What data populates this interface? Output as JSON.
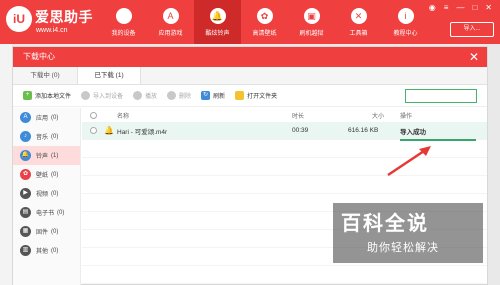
{
  "app": {
    "brand": "爱思助手",
    "url": "www.i4.cn",
    "nav": [
      {
        "label": "我的设备",
        "icon": "apple-icon",
        "glyph": ""
      },
      {
        "label": "应用游戏",
        "icon": "appstore-icon",
        "glyph": "A"
      },
      {
        "label": "酷炫铃声",
        "icon": "bell-icon",
        "glyph": "🔔"
      },
      {
        "label": "高清壁纸",
        "icon": "flower-icon",
        "glyph": "✿"
      },
      {
        "label": "刷机越狱",
        "icon": "box-icon",
        "glyph": "▣"
      },
      {
        "label": "工具箱",
        "icon": "wrench-icon",
        "glyph": "✕"
      },
      {
        "label": "教程中心",
        "icon": "info-icon",
        "glyph": "i"
      }
    ],
    "window_controls": [
      "◉",
      "≡",
      "—",
      "□",
      "✕"
    ],
    "import_label": "导入..."
  },
  "dialog": {
    "title": "下载中心",
    "close": "✕",
    "tabs": [
      {
        "label": "下载中 (0)"
      },
      {
        "label": "已下载 (1)"
      }
    ],
    "toolbar": {
      "add_local": "添加本地文件",
      "import_device": "导入到设备",
      "locate": "播放",
      "delete": "删除",
      "refresh": "刷新",
      "open_folder": "打开文件夹"
    },
    "sidebar": [
      {
        "label": "应用",
        "count": "(0)",
        "color": "#3f8bd8",
        "glyph": "A"
      },
      {
        "label": "音乐",
        "count": "(0)",
        "color": "#3f8bd8",
        "glyph": "♪"
      },
      {
        "label": "铃声",
        "count": "(1)",
        "color": "#3f8bd8",
        "glyph": "🔔"
      },
      {
        "label": "壁纸",
        "count": "(0)",
        "color": "#e8434b",
        "glyph": "✿"
      },
      {
        "label": "视频",
        "count": "(0)",
        "color": "#555555",
        "glyph": "▶"
      },
      {
        "label": "电子书",
        "count": "(0)",
        "color": "#555555",
        "glyph": "▤"
      },
      {
        "label": "固件",
        "count": "(0)",
        "color": "#555555",
        "glyph": "▦"
      },
      {
        "label": "其他",
        "count": "(0)",
        "color": "#555555",
        "glyph": "▥"
      }
    ],
    "table": {
      "headers": {
        "name": "名称",
        "time": "时长",
        "size": "大小",
        "op": "操作"
      },
      "rows": [
        {
          "name": "Hari - 可爱颂.m4r",
          "time": "00:39",
          "size": "616.16 KB",
          "op": "导入成功"
        }
      ]
    }
  },
  "watermark": {
    "main": "百科全说",
    "sub": "助你轻松解决"
  },
  "colors": {
    "brand_red": "#ef3f3f",
    "success_green": "#3aa56a",
    "selected_row": "#eaf6f2",
    "active_side": "#ffdcdc"
  }
}
